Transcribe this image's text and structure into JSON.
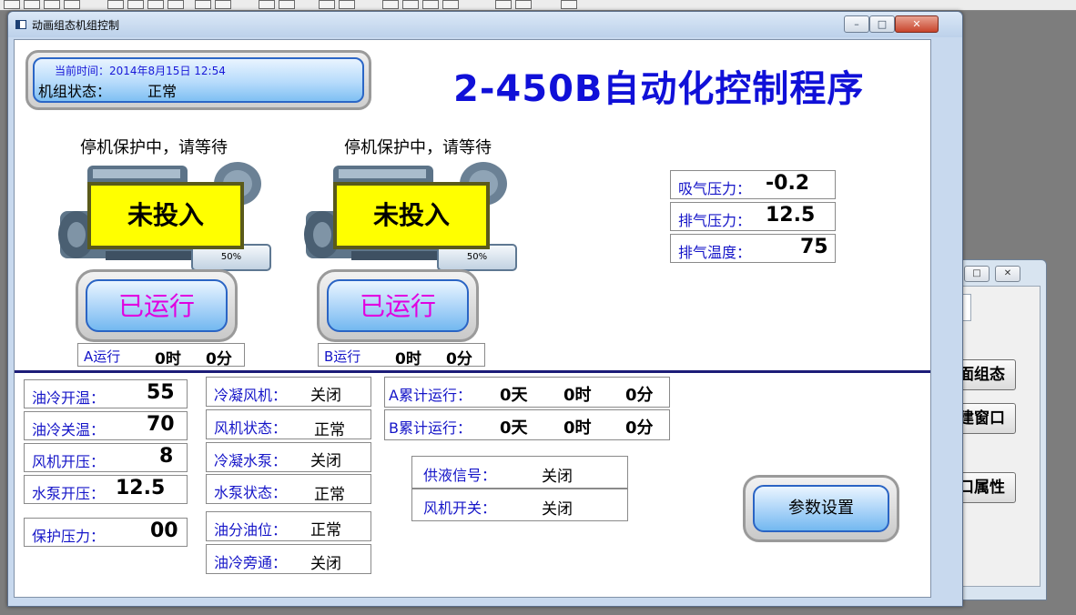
{
  "background_window": {
    "buttons": [
      {
        "label": "面组态"
      },
      {
        "label": "建窗口"
      },
      {
        "label": "口属性"
      }
    ],
    "controls": {
      "restore": "□",
      "close": "✕"
    }
  },
  "window": {
    "title": "动画组态机组控制",
    "controls": {
      "minimize": "–",
      "maximize": "□",
      "close": "✕"
    }
  },
  "header": {
    "current_time": "当前时间：2014年8月15日 12:54",
    "unit_state_label": "机组状态：",
    "unit_state_value": "正常",
    "title": "2-450B自动化控制程序"
  },
  "units": [
    {
      "status_text": "停机保护中，请等待",
      "overlay": "未投入",
      "percent": "50%",
      "run_button": "已运行",
      "run_label": "A运行",
      "run_hours": "0时",
      "run_minutes": "0分"
    },
    {
      "status_text": "停机保护中，请等待",
      "overlay": "未投入",
      "percent": "50%",
      "run_button": "已运行",
      "run_label": "B运行",
      "run_hours": "0时",
      "run_minutes": "0分"
    }
  ],
  "pressures": [
    {
      "label": "吸气压力：",
      "value": "-0.2"
    },
    {
      "label": "排气压力：",
      "value": "12.5"
    },
    {
      "label": "排气温度：",
      "value": "75"
    }
  ],
  "settings": [
    {
      "label": "油冷开温：",
      "value": "55"
    },
    {
      "label": "油冷关温：",
      "value": "70"
    },
    {
      "label": "风机开压：",
      "value": "8"
    },
    {
      "label": "水泵开压：",
      "value": "12.5"
    },
    {
      "label": "保护压力：",
      "value": "00"
    }
  ],
  "equipment": [
    {
      "label": "冷凝风机：",
      "value": "关闭"
    },
    {
      "label": "风机状态：",
      "value": "正常"
    },
    {
      "label": "冷凝水泵：",
      "value": "关闭"
    },
    {
      "label": "水泵状态：",
      "value": "正常"
    },
    {
      "label": "油分油位：",
      "value": "正常"
    },
    {
      "label": "油冷旁通：",
      "value": "关闭"
    }
  ],
  "cumulative": [
    {
      "label": "A累计运行：",
      "days": "0天",
      "hours": "0时",
      "minutes": "0分"
    },
    {
      "label": "B累计运行：",
      "days": "0天",
      "hours": "0时",
      "minutes": "0分"
    }
  ],
  "signals": [
    {
      "label": "供液信号：",
      "value": "关闭"
    },
    {
      "label": "风机开关：",
      "value": "关闭"
    }
  ],
  "param_button": "参数设置",
  "colors": {
    "accent_blue": "#1010d8",
    "label_blue": "#1515c8",
    "run_magenta": "#e000e0",
    "overlay_yellow": "#ffff00"
  }
}
